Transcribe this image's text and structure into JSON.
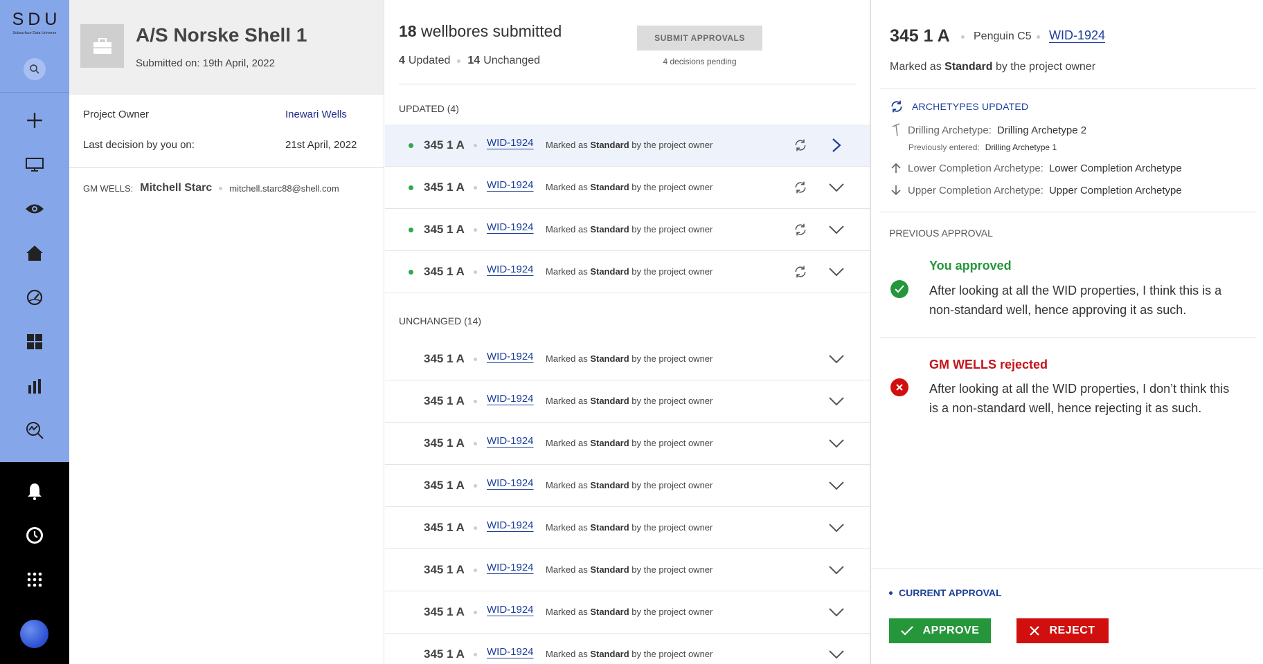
{
  "app": {
    "logo": "SDU",
    "logo_subtitle": "Subsurface Data Universe"
  },
  "rail": {
    "icons": [
      "search-icon",
      "plus-icon",
      "monitor-icon",
      "eye-icon",
      "home-icon",
      "gauge-icon",
      "dashboard-grid-icon",
      "bar-chart-icon",
      "analytics-search-icon",
      "bell-icon",
      "history-icon",
      "apps-grid-icon"
    ]
  },
  "project": {
    "title": "A/S Norske Shell 1",
    "submitted": "Submitted on: 19th April, 2022",
    "owner_label": "Project Owner",
    "owner_value": "Inewari Wells",
    "last_decision_label": "Last decision by you on:",
    "last_decision_value": "21st April, 2022",
    "gm_label": "GM WELLS:",
    "gm_name": "Mitchell Starc",
    "gm_email": "mitchell.starc88@shell.com"
  },
  "list": {
    "count": "18",
    "title_suffix": "wellbores submitted",
    "updated_count": "4",
    "updated_label": "Updated",
    "unchanged_count": "14",
    "unchanged_label": "Unchanged",
    "submit_label": "SUBMIT APPROVALS",
    "pending": "4 decisions pending",
    "updated_header": "UPDATED (4)",
    "unchanged_header": "UNCHANGED (14)",
    "status_prefix": "Marked as",
    "status_bold": "Standard",
    "status_suffix": "by the project owner",
    "updated_rows": [
      {
        "name": "345 1 A",
        "wid": "WID-1924"
      },
      {
        "name": "345 1 A",
        "wid": "WID-1924"
      },
      {
        "name": "345 1 A",
        "wid": "WID-1924"
      },
      {
        "name": "345 1 A",
        "wid": "WID-1924"
      }
    ],
    "unchanged_rows": [
      {
        "name": "345 1 A",
        "wid": "WID-1924"
      },
      {
        "name": "345 1 A",
        "wid": "WID-1924"
      },
      {
        "name": "345 1 A",
        "wid": "WID-1924"
      },
      {
        "name": "345 1 A",
        "wid": "WID-1924"
      },
      {
        "name": "345 1 A",
        "wid": "WID-1924"
      },
      {
        "name": "345 1 A",
        "wid": "WID-1924"
      },
      {
        "name": "345 1 A",
        "wid": "WID-1924"
      },
      {
        "name": "345 1 A",
        "wid": "WID-1924"
      }
    ]
  },
  "detail": {
    "title": "345 1 A",
    "field": "Penguin C5",
    "wid": "WID-1924",
    "marked_prefix": "Marked as",
    "marked_bold": "Standard",
    "marked_suffix": "by the project owner",
    "arch_header": "ARCHETYPES UPDATED",
    "drilling_label": "Drilling Archetype:",
    "drilling_value": "Drilling Archetype 2",
    "prev_entered_label": "Previously entered:",
    "prev_entered_value": "Drilling Archetype 1",
    "lower_label": "Lower Completion Archetype:",
    "lower_value": "Lower Completion Archetype",
    "upper_label": "Upper Completion Archetype:",
    "upper_value": "Upper Completion Archetype",
    "prev_approval_header": "PREVIOUS APPROVAL",
    "you_title": "You approved",
    "you_text": "After looking at all the WID properties, I think this is a non-standard well, hence approving it as such.",
    "gm_title": "GM WELLS rejected",
    "gm_text": "After looking at all the WID properties, I don’t think this is a non-standard well, hence rejecting it as such.",
    "current_header": "CURRENT APPROVAL",
    "approve_label": "APPROVE",
    "reject_label": "REJECT"
  },
  "colors": {
    "rail_top": "#86a6ea",
    "link": "#1c3e9a",
    "approve": "#26963b",
    "reject": "#d10f0f",
    "updated_dot": "#2fa84f"
  }
}
